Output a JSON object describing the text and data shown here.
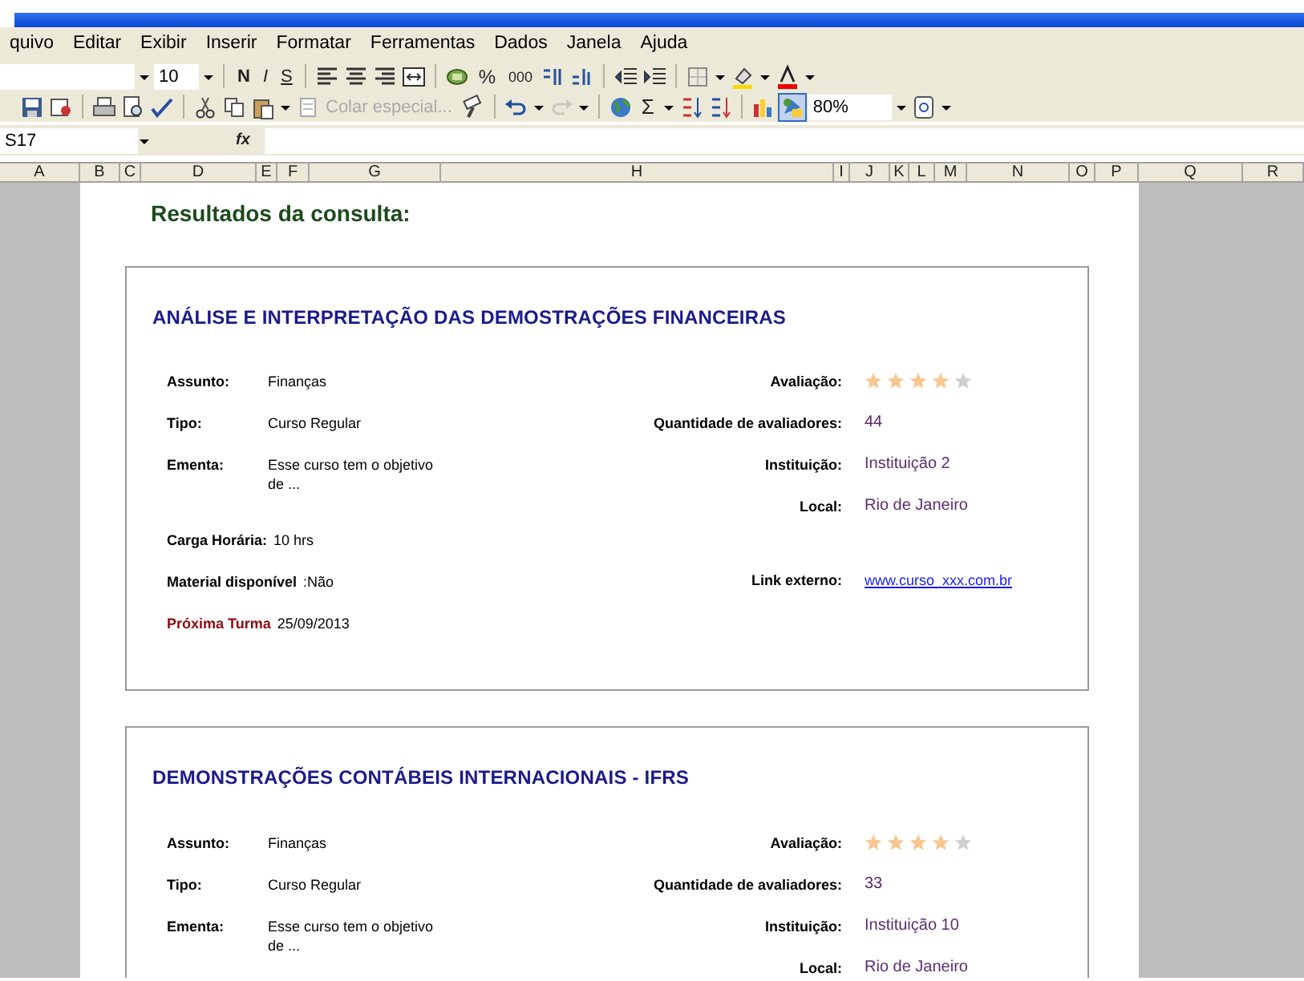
{
  "menu": [
    "quivo",
    "Editar",
    "Exibir",
    "Inserir",
    "Formatar",
    "Ferramentas",
    "Dados",
    "Janela",
    "Ajuda"
  ],
  "formatting_toolbar": {
    "font_size": "10",
    "text_buttons": [
      "N",
      "I",
      "S"
    ],
    "number_buttons": [
      "%",
      "000"
    ]
  },
  "standard_toolbar": {
    "paste_special": {
      "label": "Colar especial...",
      "disabled": true
    },
    "redo_disabled": true,
    "sum": "Σ",
    "drawing_pressed": true,
    "zoom": "80%"
  },
  "formula_bar": {
    "name_box": "S17",
    "fx": "fx"
  },
  "columns": [
    "A",
    "B",
    "C",
    "D",
    "E",
    "F",
    "G",
    "H",
    "I",
    "J",
    "K",
    "L",
    "M",
    "N",
    "O",
    "P",
    "Q",
    "R"
  ],
  "heading": "Resultados da consulta:",
  "courses": [
    {
      "title": "ANÁLISE E INTERPRETAÇÃO DAS DEMOSTRAÇÕES FINANCEIRAS",
      "left_fields": [
        {
          "kind": "field",
          "label": "Assunto:",
          "value": "Finanças"
        },
        {
          "kind": "field",
          "label": "Tipo:",
          "value": "Curso Regular"
        },
        {
          "kind": "field",
          "label": "Ementa:",
          "value": "Esse curso tem o objetivo de ..."
        },
        {
          "kind": "inline",
          "label": "Carga Horária:",
          "value": "10 hrs"
        },
        {
          "kind": "inline",
          "label": "Material disponível",
          "value": ":Não"
        },
        {
          "kind": "highlight",
          "label": "Próxima Turma",
          "value": "25/09/2013"
        }
      ],
      "right_fields": [
        {
          "kind": "stars",
          "label": "Avaliação:",
          "stars": 4
        },
        {
          "kind": "text",
          "label": "Quantidade de avaliadores:",
          "value": "44"
        },
        {
          "kind": "text",
          "label": "Instituição:",
          "value": "Instituição 2"
        },
        {
          "kind": "text",
          "label": "Local:",
          "value": "Rio de Janeiro"
        },
        {
          "kind": "link",
          "label": "Link externo:",
          "value": "www.curso_xxx.com.br"
        }
      ]
    },
    {
      "title": "DEMONSTRAÇÕES CONTÁBEIS INTERNACIONAIS - IFRS",
      "left_fields": [
        {
          "kind": "field",
          "label": "Assunto:",
          "value": "Finanças"
        },
        {
          "kind": "field",
          "label": "Tipo:",
          "value": "Curso Regular"
        },
        {
          "kind": "field",
          "label": "Ementa:",
          "value": "Esse curso tem o objetivo de ..."
        }
      ],
      "right_fields": [
        {
          "kind": "stars",
          "label": "Avaliação:",
          "stars": 4
        },
        {
          "kind": "text",
          "label": "Quantidade de avaliadores:",
          "value": "33"
        },
        {
          "kind": "text",
          "label": "Instituição:",
          "value": "Instituição 10"
        },
        {
          "kind": "text",
          "label": "Local:",
          "value": "Rio de Janeiro"
        }
      ]
    }
  ]
}
